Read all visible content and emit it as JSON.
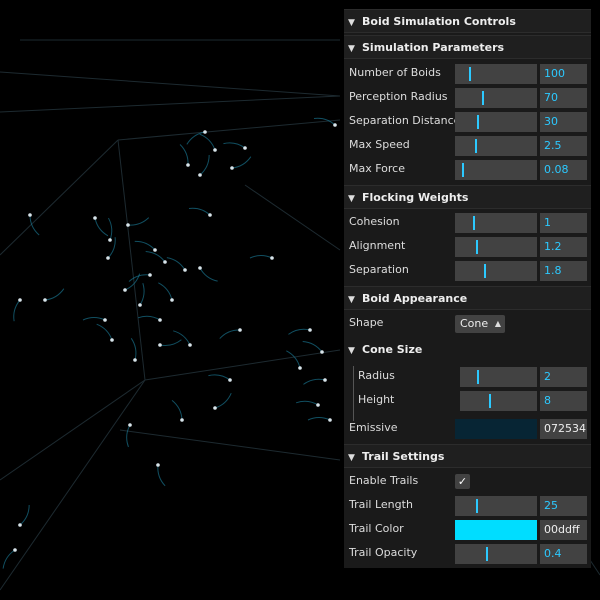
{
  "panel": {
    "title": "Boid Simulation Controls",
    "sections": {
      "simulation": {
        "title": "Simulation Parameters",
        "controls": [
          {
            "label": "Number of Boids",
            "value": "100",
            "level": 0.15
          },
          {
            "label": "Perception Radius",
            "value": "70",
            "level": 0.32
          },
          {
            "label": "Separation Distance",
            "value": "30",
            "level": 0.25
          },
          {
            "label": "Max Speed",
            "value": "2.5",
            "level": 0.23
          },
          {
            "label": "Max Force",
            "value": "0.08",
            "level": 0.05
          }
        ]
      },
      "flocking": {
        "title": "Flocking Weights",
        "controls": [
          {
            "label": "Cohesion",
            "value": "1",
            "level": 0.2
          },
          {
            "label": "Alignment",
            "value": "1.2",
            "level": 0.24
          },
          {
            "label": "Separation",
            "value": "1.8",
            "level": 0.35
          }
        ]
      },
      "appearance": {
        "title": "Boid Appearance",
        "shape_label": "Shape",
        "shape_value": "Cone",
        "cone_size": {
          "title": "Cone Size",
          "controls": [
            {
              "label": "Radius",
              "value": "2",
              "level": 0.2
            },
            {
              "label": "Height",
              "value": "8",
              "level": 0.38
            }
          ]
        },
        "emissive_label": "Emissive",
        "emissive_value": "072534",
        "emissive_color": "#072534"
      },
      "trail": {
        "title": "Trail Settings",
        "enable_label": "Enable Trails",
        "enable_checked": true,
        "length_label": "Trail Length",
        "length_value": "25",
        "length_level": 0.24,
        "color_label": "Trail Color",
        "color_value": "00ddff",
        "color_hex": "#00ddff",
        "opacity_label": "Trail Opacity",
        "opacity_value": "0.4",
        "opacity_level": 0.38
      }
    }
  },
  "icons": {
    "chevron": "chevron-down-icon",
    "check": "check-icon",
    "select_arrows": "up-down-arrows-icon"
  },
  "colors": {
    "accent": "#2cc9ff",
    "panel_bg": "#1a1a1a",
    "control_bg": "#424242",
    "scene_bg": "#000000"
  }
}
